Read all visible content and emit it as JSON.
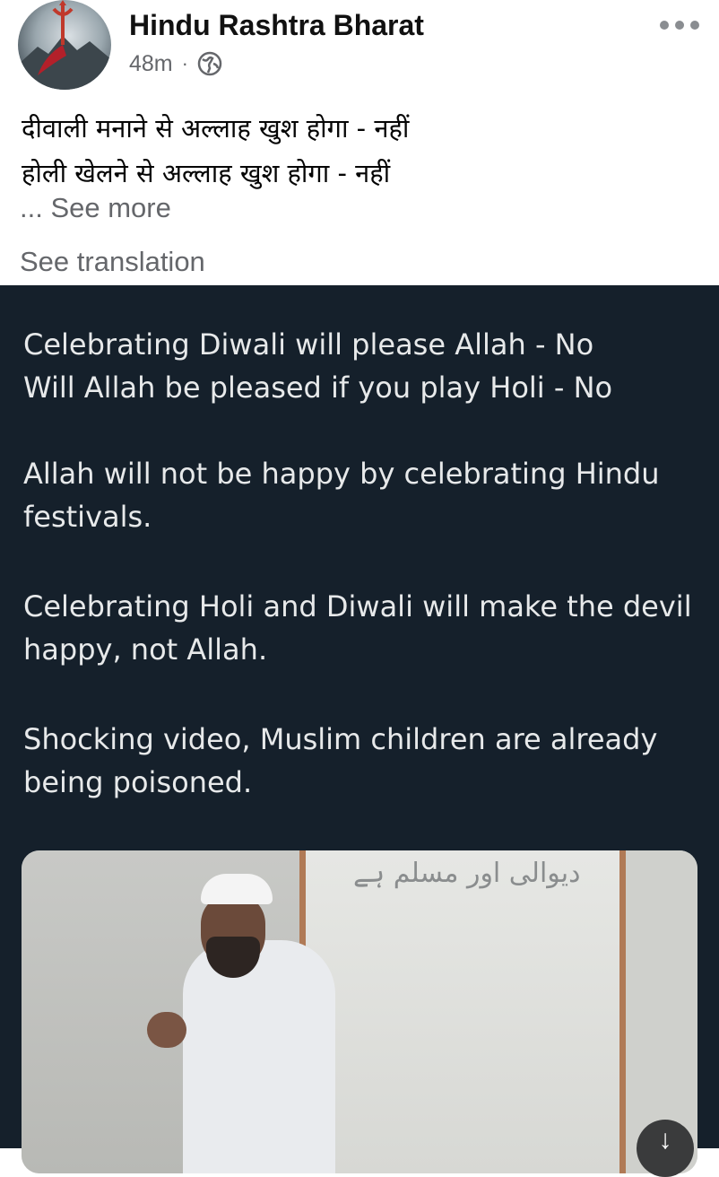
{
  "post": {
    "page_name": "Hindu Rashtra Bharat",
    "time": "48m",
    "separator": "·",
    "visibility_icon": "globe-icon",
    "text_line1": "दीवाली मनाने से अल्लाह खुश होगा - नहीं",
    "text_line2": "होली खेलने से अल्लाह खुश होगा - नहीं",
    "see_more": "... See more",
    "see_translation": "See translation"
  },
  "tweet": {
    "line1": "Celebrating Diwali will please Allah - No",
    "line2": "Will Allah be pleased if you play Holi - No",
    "para2": "Allah will not be happy by celebrating Hindu festivals.",
    "para3": "Celebrating Holi and Diwali will make the devil happy, not Allah.",
    "para4": "Shocking video, Muslim children are already being poisoned.",
    "board_text": "دیوالی اور مسلم ہے"
  },
  "ui": {
    "more_icon": "more-options-icon",
    "download_icon": "download-icon",
    "download_glyph": "↓"
  },
  "colors": {
    "tweet_background": "#15202b",
    "tweet_text": "#e7e9ea",
    "secondary_text": "#65676b"
  }
}
